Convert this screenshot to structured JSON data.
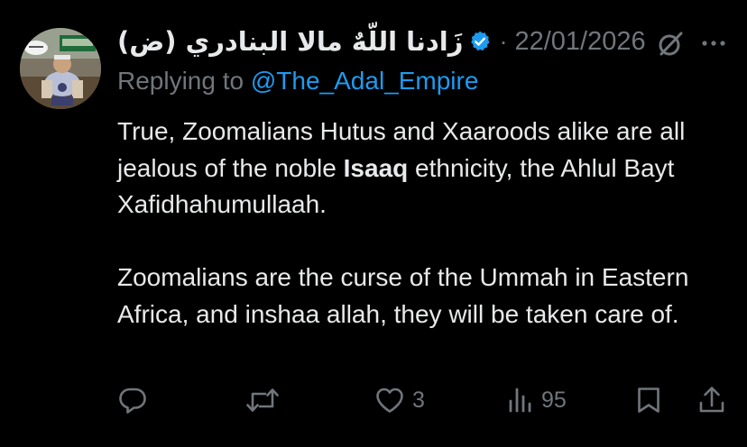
{
  "author": {
    "display_name": "زَادنا اللّهٌ مالا البنادري (ض)",
    "verified": true,
    "separator": "·",
    "date": "22/01/2026",
    "avatar_icon": "cartoon-character-avatar"
  },
  "reply": {
    "prefix": "Replying to ",
    "mention": "@The_Adal_Empire"
  },
  "body": {
    "p1_a": "True, Zoomalians Hutus and Xaaroods alike are all jealous of the noble ",
    "p1_bold": "Isaaq",
    "p1_b": " ethnicity, the Ahlul Bayt Xafidhahumullaah.",
    "p2": "Zoomalians are the curse of the Ummah in Eastern Africa, and inshaa allah, they will be taken care of."
  },
  "actions": {
    "reply_icon": "reply-icon",
    "retweet_icon": "retweet-icon",
    "like_icon": "heart-icon",
    "like_count": "3",
    "views_icon": "views-icon",
    "views_count": "95",
    "bookmark_icon": "bookmark-icon",
    "share_icon": "share-icon"
  },
  "colors": {
    "background": "#000000",
    "text": "#e7e9ea",
    "muted": "#71767b",
    "accent": "#1d9bf0"
  }
}
